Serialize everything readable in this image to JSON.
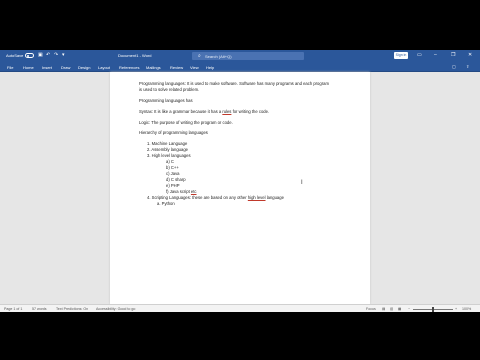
{
  "titlebar": {
    "autosave_label": "AutoSave",
    "autosave_state": "Off",
    "save_icon": "save-icon",
    "undo_icon": "undo-icon",
    "redo_icon": "redo-icon",
    "customize_icon": "chevron-down-icon",
    "document_title": "Document1  -  Word",
    "search_placeholder": "Search (Alt+Q)",
    "sign_in_label": "Sign in",
    "window_buttons": [
      "minimize",
      "restore",
      "close"
    ]
  },
  "menu": {
    "tabs": [
      "File",
      "Home",
      "Insert",
      "Draw",
      "Design",
      "Layout",
      "References",
      "Mailings",
      "Review",
      "View",
      "Help"
    ],
    "right_buttons": [
      "comment-icon",
      "share-icon"
    ]
  },
  "document": {
    "lines": [
      "Programming languages: It is used to make software. Software has many programs and each program",
      "is used to solve related problem.",
      "Programming languages has",
      "Syntax: It is like a grammar because it has a rules for writing the code.",
      "Logic: The purpose of writing the program or code.",
      "Hierarchy of programming languages",
      "1.    Machine Language",
      "2.    Assembly language",
      "3.    High level languages",
      "a)    C",
      "b)    C++",
      "c)    Java",
      "d)    C sharp",
      "e)    PHP",
      "f)     Java script",
      "etc",
      "4.    Scripting Languages: these are based on any other",
      "high level",
      "language",
      "a.    Python"
    ]
  },
  "statusbar": {
    "page_info": "Page 1 of 1",
    "word_count": "57 words",
    "text_predictions": "Text Predictions: On",
    "accessibility": "Accessibility: Good to go",
    "focus": "Focus",
    "zoom": "100%"
  }
}
